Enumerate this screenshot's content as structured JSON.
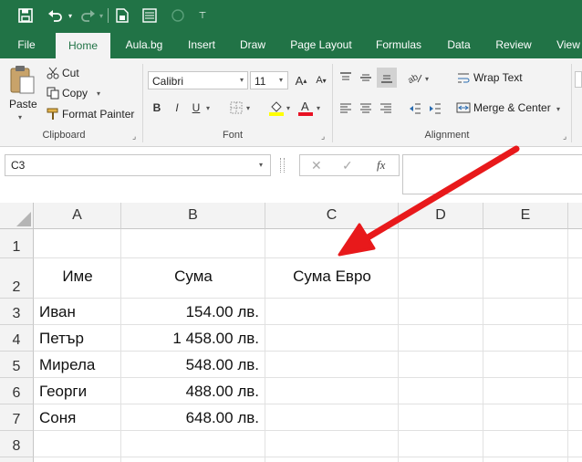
{
  "colors": {
    "accent": "#217346",
    "ribbon": "#f3f3f3",
    "arrow": "#e8191b"
  },
  "quick_access": {
    "icons": [
      "save-icon",
      "undo-icon",
      "redo-icon",
      "new-file-icon",
      "form-icon",
      "circle-icon",
      "customize-icon"
    ]
  },
  "tabs": [
    "File",
    "Home",
    "Aula.bg",
    "Insert",
    "Draw",
    "Page Layout",
    "Formulas",
    "Data",
    "Review",
    "View"
  ],
  "active_tab": "Home",
  "ribbon": {
    "clipboard": {
      "paste": "Paste",
      "cut": "Cut",
      "copy": "Copy",
      "format_painter": "Format Painter",
      "label": "Clipboard"
    },
    "font": {
      "name": "Calibri",
      "size": "11",
      "bold": "B",
      "italic": "I",
      "underline": "U",
      "label": "Font"
    },
    "alignment": {
      "wrap_text": "Wrap Text",
      "merge_center": "Merge & Center",
      "label": "Alignment"
    }
  },
  "formula_bar": {
    "name_box": "C3",
    "cancel": "✕",
    "enter": "✓",
    "fx": "fx",
    "value": ""
  },
  "sheet": {
    "columns": [
      "A",
      "B",
      "C",
      "D",
      "E"
    ],
    "rows": [
      "1",
      "2",
      "3",
      "4",
      "5",
      "6",
      "7",
      "8"
    ],
    "headers": {
      "a2": "Име",
      "b2": "Сума",
      "c2": "Сума Евро"
    },
    "data": [
      {
        "name": "Иван",
        "amount": "154.00 лв."
      },
      {
        "name": "Петър",
        "amount": "1 458.00 лв."
      },
      {
        "name": "Мирела",
        "amount": "548.00 лв."
      },
      {
        "name": "Георги",
        "amount": "488.00 лв."
      },
      {
        "name": "Соня",
        "amount": "648.00 лв."
      }
    ]
  }
}
